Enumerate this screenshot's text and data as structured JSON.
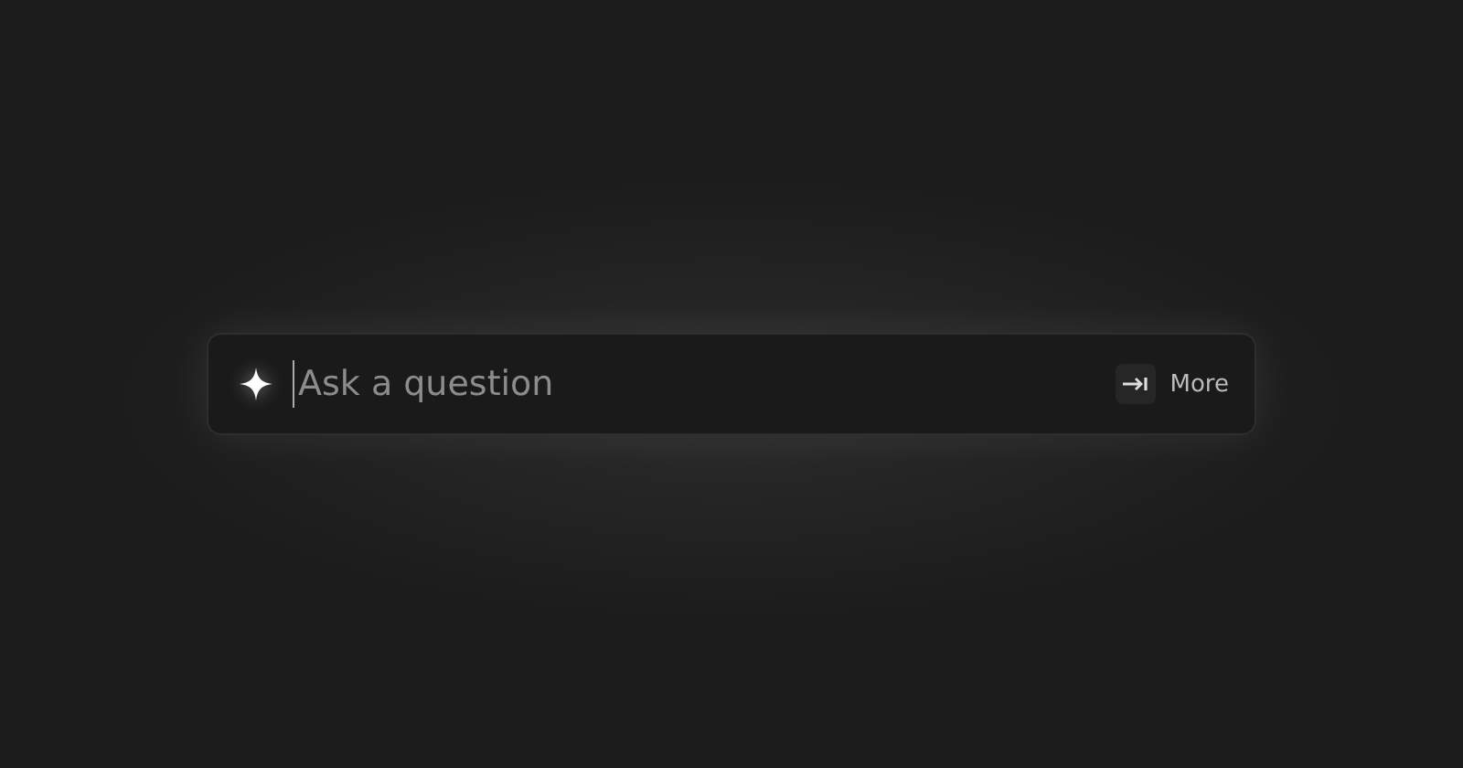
{
  "search": {
    "placeholder": "Ask a question"
  },
  "more_button": {
    "label": "More"
  }
}
